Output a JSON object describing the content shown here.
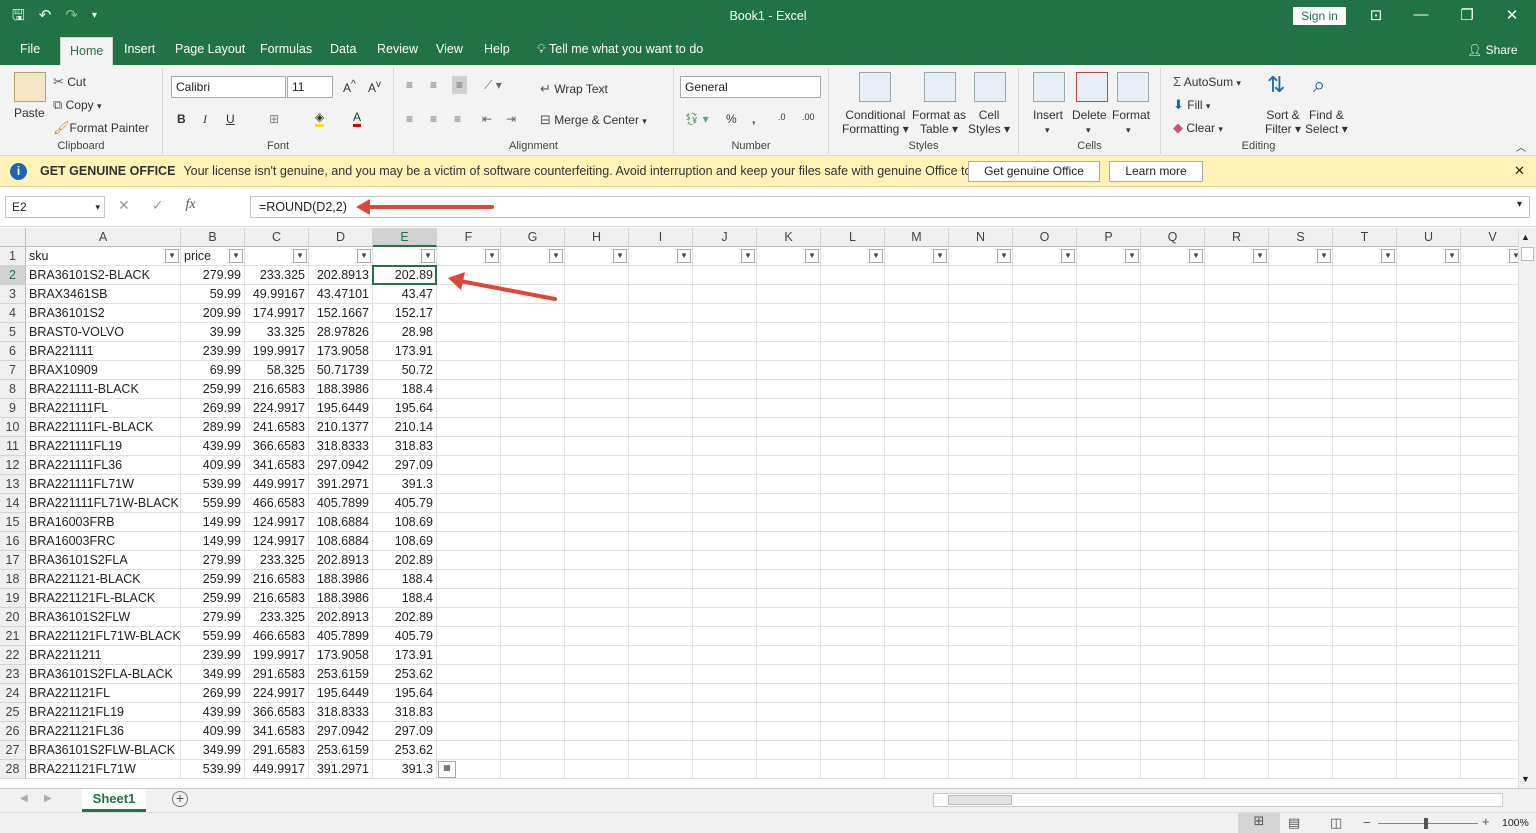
{
  "window": {
    "title": "Book1  -  Excel",
    "sign_in": "Sign in"
  },
  "tabs": [
    "File",
    "Home",
    "Insert",
    "Page Layout",
    "Formulas",
    "Data",
    "Review",
    "View",
    "Help"
  ],
  "tell_me": "Tell me what you want to do",
  "share": "Share",
  "ribbon": {
    "clipboard": {
      "paste": "Paste",
      "cut": "Cut",
      "copy": "Copy",
      "format_painter": "Format Painter",
      "label": "Clipboard"
    },
    "font": {
      "name": "Calibri",
      "size": "11",
      "label": "Font"
    },
    "alignment": {
      "wrap": "Wrap Text",
      "merge": "Merge & Center",
      "label": "Alignment"
    },
    "number": {
      "format": "General",
      "label": "Number"
    },
    "styles": {
      "conditional": "Conditional",
      "conditional2": "Formatting",
      "format_as": "Format as",
      "format_as2": "Table",
      "cell": "Cell",
      "cell2": "Styles",
      "label": "Styles"
    },
    "cells": {
      "insert": "Insert",
      "delete": "Delete",
      "format": "Format",
      "label": "Cells"
    },
    "editing": {
      "autosum": "AutoSum",
      "fill": "Fill",
      "clear": "Clear",
      "sort": "Sort &",
      "sort2": "Filter",
      "find": "Find &",
      "find2": "Select",
      "label": "Editing"
    }
  },
  "banner": {
    "title": "GET GENUINE OFFICE",
    "message": "Your license isn't genuine, and you may be a victim of software counterfeiting. Avoid interruption and keep your files safe with genuine Office today.",
    "btn1": "Get genuine Office",
    "btn2": "Learn more"
  },
  "formula_bar": {
    "name_box": "E2",
    "formula": "=ROUND(D2,2)"
  },
  "columns": [
    "A",
    "B",
    "C",
    "D",
    "E",
    "F",
    "G",
    "H",
    "I",
    "J",
    "K",
    "L",
    "M",
    "N",
    "O",
    "P",
    "Q",
    "R",
    "S",
    "T",
    "U",
    "V"
  ],
  "headers": [
    "sku",
    "price",
    "",
    "",
    ""
  ],
  "rows": [
    [
      "BRA36101S2-BLACK",
      "279.99",
      "233.325",
      "202.8913",
      "202.89"
    ],
    [
      "BRAX3461SB",
      "59.99",
      "49.99167",
      "43.47101",
      "43.47"
    ],
    [
      "BRA36101S2",
      "209.99",
      "174.9917",
      "152.1667",
      "152.17"
    ],
    [
      "BRAST0-VOLVO",
      "39.99",
      "33.325",
      "28.97826",
      "28.98"
    ],
    [
      "BRA221111",
      "239.99",
      "199.9917",
      "173.9058",
      "173.91"
    ],
    [
      "BRAX10909",
      "69.99",
      "58.325",
      "50.71739",
      "50.72"
    ],
    [
      "BRA221111-BLACK",
      "259.99",
      "216.6583",
      "188.3986",
      "188.4"
    ],
    [
      "BRA221111FL",
      "269.99",
      "224.9917",
      "195.6449",
      "195.64"
    ],
    [
      "BRA221111FL-BLACK",
      "289.99",
      "241.6583",
      "210.1377",
      "210.14"
    ],
    [
      "BRA221111FL19",
      "439.99",
      "366.6583",
      "318.8333",
      "318.83"
    ],
    [
      "BRA221111FL36",
      "409.99",
      "341.6583",
      "297.0942",
      "297.09"
    ],
    [
      "BRA221111FL71W",
      "539.99",
      "449.9917",
      "391.2971",
      "391.3"
    ],
    [
      "BRA221111FL71W-BLACK",
      "559.99",
      "466.6583",
      "405.7899",
      "405.79"
    ],
    [
      "BRA16003FRB",
      "149.99",
      "124.9917",
      "108.6884",
      "108.69"
    ],
    [
      "BRA16003FRC",
      "149.99",
      "124.9917",
      "108.6884",
      "108.69"
    ],
    [
      "BRA36101S2FLA",
      "279.99",
      "233.325",
      "202.8913",
      "202.89"
    ],
    [
      "BRA221121-BLACK",
      "259.99",
      "216.6583",
      "188.3986",
      "188.4"
    ],
    [
      "BRA221121FL-BLACK",
      "259.99",
      "216.6583",
      "188.3986",
      "188.4"
    ],
    [
      "BRA36101S2FLW",
      "279.99",
      "233.325",
      "202.8913",
      "202.89"
    ],
    [
      "BRA221121FL71W-BLACK",
      "559.99",
      "466.6583",
      "405.7899",
      "405.79"
    ],
    [
      "BRA2211211",
      "239.99",
      "199.9917",
      "173.9058",
      "173.91"
    ],
    [
      "BRA36101S2FLA-BLACK",
      "349.99",
      "291.6583",
      "253.6159",
      "253.62"
    ],
    [
      "BRA221121FL",
      "269.99",
      "224.9917",
      "195.6449",
      "195.64"
    ],
    [
      "BRA221121FL19",
      "439.99",
      "366.6583",
      "318.8333",
      "318.83"
    ],
    [
      "BRA221121FL36",
      "409.99",
      "341.6583",
      "297.0942",
      "297.09"
    ],
    [
      "BRA36101S2FLW-BLACK",
      "349.99",
      "291.6583",
      "253.6159",
      "253.62"
    ],
    [
      "BRA221121FL71W",
      "539.99",
      "449.9917",
      "391.2971",
      "391.3"
    ]
  ],
  "sheet": {
    "name": "Sheet1"
  },
  "zoom": "100%"
}
